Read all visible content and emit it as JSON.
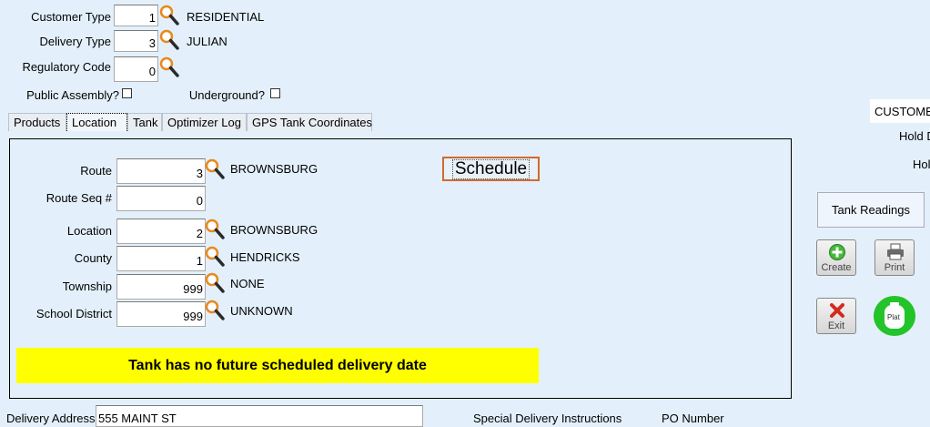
{
  "header": {
    "customer_type": {
      "label": "Customer Type",
      "value": "1",
      "desc": "RESIDENTIAL"
    },
    "delivery_type": {
      "label": "Delivery Type",
      "value": "3",
      "desc": "JULIAN"
    },
    "regulatory_code": {
      "label": "Regulatory Code",
      "value": "0"
    },
    "public_assembly_label": "Public Assembly?",
    "underground_label": "Underground?"
  },
  "tabs": [
    "Products",
    "Location",
    "Tank",
    "Optimizer Log",
    "GPS Tank Coordinates"
  ],
  "location": {
    "route": {
      "label": "Route",
      "value": "3",
      "desc": "BROWNSBURG"
    },
    "route_seq": {
      "label": "Route Seq #",
      "value": "0"
    },
    "location": {
      "label": "Location",
      "value": "2",
      "desc": "BROWNSBURG"
    },
    "county": {
      "label": "County",
      "value": "1",
      "desc": "HENDRICKS"
    },
    "township": {
      "label": "Township",
      "value": "999",
      "desc": "NONE"
    },
    "school_district": {
      "label": "School District",
      "value": "999",
      "desc": "UNKNOWN"
    },
    "schedule_label": "Schedule",
    "warning": "Tank has no future scheduled delivery date"
  },
  "right": {
    "customer_label": "CUSTOME",
    "hold_d_label": "Hold D",
    "hold_label": "Hol",
    "tank_readings_label": "Tank Readings",
    "create_label": "Create",
    "print_label": "Print",
    "exit_label": "Exit",
    "plat_label": "Plat"
  },
  "footer": {
    "delivery_address_label": "Delivery Address",
    "delivery_address_value": "555 MAINT ST",
    "special_instructions_label": "Special Delivery Instructions",
    "po_number_label": "PO Number"
  }
}
